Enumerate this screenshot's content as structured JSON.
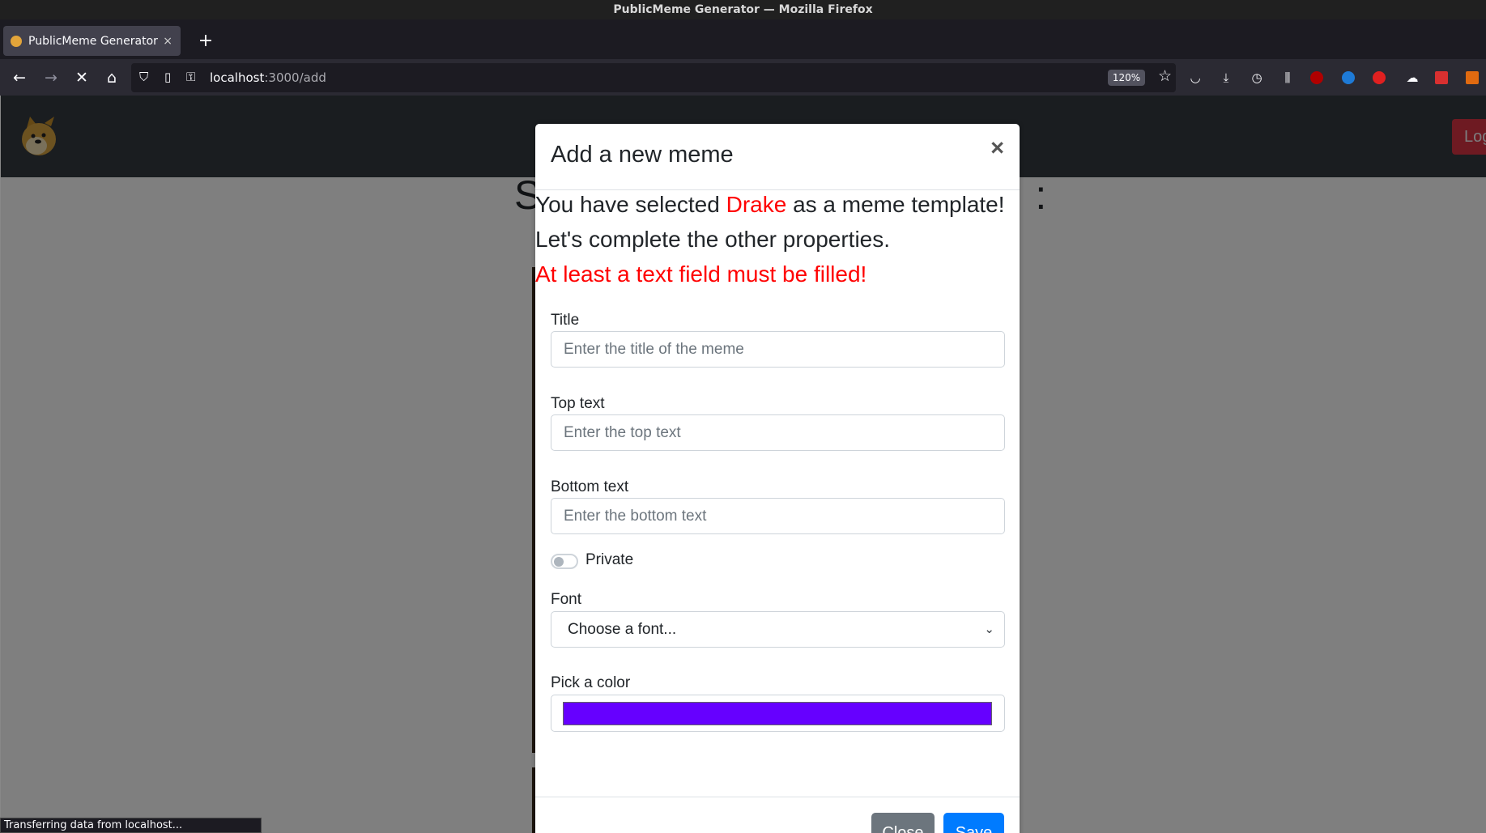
{
  "window": {
    "title": "PublicMeme Generator — Mozilla Firefox"
  },
  "tab": {
    "title": "PublicMeme Generator",
    "close": "×",
    "new_tab": "+"
  },
  "nav": {
    "url_host": "localhost",
    "url_path": ":3000/add",
    "zoom": "120%"
  },
  "app": {
    "login_label": "Log",
    "heading_left": "S",
    "heading_right": ":"
  },
  "modal": {
    "title": "Add a new meme",
    "close_glyph": "×",
    "selected_prefix": "You have selected ",
    "selected_template": "Drake",
    "selected_suffix": " as a meme template!",
    "complete_msg": "Let's complete the other properties.",
    "error_msg": "At least a text field must be filled!",
    "title_label": "Title",
    "title_placeholder": "Enter the title of the meme",
    "top_label": "Top text",
    "top_placeholder": "Enter the top text",
    "bottom_label": "Bottom text",
    "bottom_placeholder": "Enter the bottom text",
    "private_label": "Private",
    "private_checked": false,
    "font_label": "Font",
    "font_selected": "Choose a font...",
    "color_label": "Pick a color",
    "color_value": "#6600ff",
    "close_button": "Close",
    "save_button": "Save"
  },
  "status": {
    "text": "Transferring data from localhost..."
  },
  "colors": {
    "accent_red": "#ff0000",
    "primary": "#007bff",
    "secondary": "#6c757d",
    "danger": "#dc3545",
    "navbar": "#343a40"
  }
}
